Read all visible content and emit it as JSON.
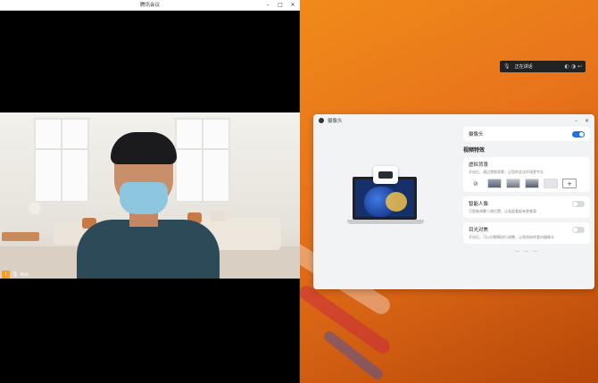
{
  "meeting": {
    "title": "腾讯会议",
    "controls": {
      "minimize": "–",
      "maximize": "□",
      "close": "✕"
    },
    "participant_name": "Bot"
  },
  "floating_bar": {
    "text": "正在讲话"
  },
  "camera_window": {
    "title": "摄像头",
    "controls": {
      "minimize": "–",
      "close": "✕"
    },
    "camera_label": "摄像头",
    "camera_on": true,
    "section_title": "视频特效",
    "virtual_bg": {
      "label": "虚拟背景",
      "desc": "开启后，通过替换背景，让您的会议环境更专业"
    },
    "auto_framing": {
      "label": "智能人像",
      "desc": "可智能调整人物位置，让画面看起来更美观",
      "on": false
    },
    "eye_contact": {
      "label": "目光对焦",
      "desc": "开启后，可以对眼睛进行调整，让视线始终看向摄像头",
      "on": false
    },
    "more": "— — —"
  },
  "icons": {
    "warn": "warning-icon",
    "mic": "microphone-icon",
    "none": "no-background-icon",
    "add": "add-icon"
  }
}
